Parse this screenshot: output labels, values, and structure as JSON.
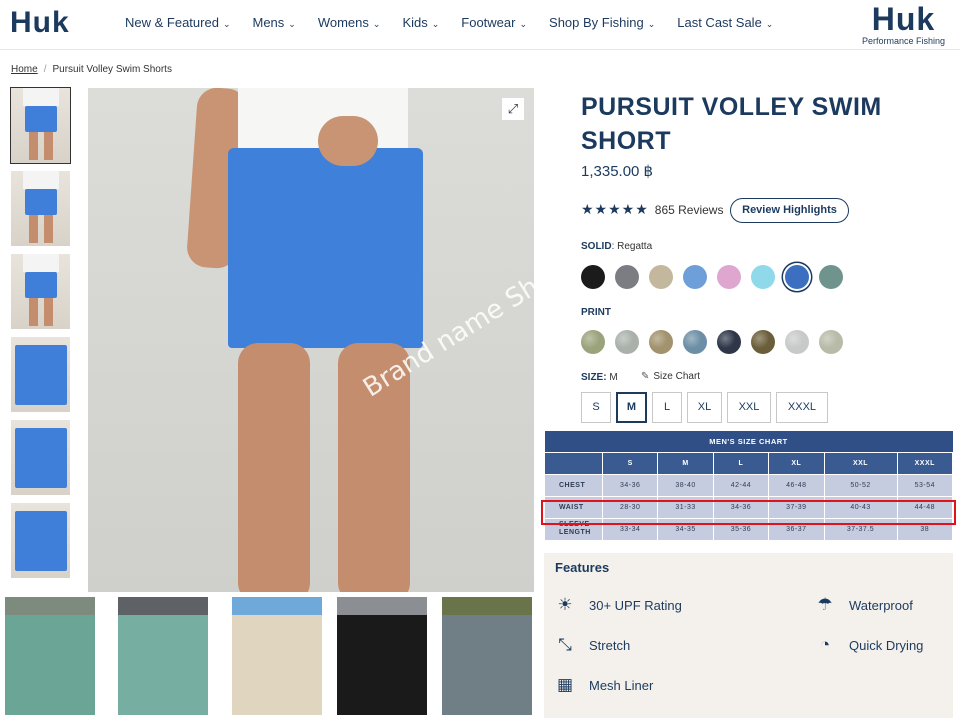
{
  "header": {
    "logo_left": "Huk",
    "nav": [
      "New & Featured",
      "Mens",
      "Womens",
      "Kids",
      "Footwear",
      "Shop By Fishing",
      "Last Cast Sale"
    ],
    "logo_right": {
      "big": "Huk",
      "small": "Performance Fishing"
    }
  },
  "breadcrumb": {
    "home": "Home",
    "current": "Pursuit Volley Swim Shorts"
  },
  "product": {
    "title": "PURSUIT VOLLEY SWIM SHORT",
    "price": "1,335.00 ฿",
    "stars": "★★★★★",
    "reviews": "865 Reviews",
    "review_highlights": "Review Highlights"
  },
  "color": {
    "label": "SOLID",
    "selected": ": Regatta",
    "swatches": [
      "#1b1b1b",
      "#7b7d82",
      "#c3b79d",
      "#6f9fd8",
      "#dfa7cf",
      "#8fd9ea",
      "#3c6fbf",
      "#6f948d"
    ],
    "selected_index": 6
  },
  "print": {
    "label": "PRINT",
    "swatches": [
      "#9aa37c",
      "#a9b1aa",
      "#a2926d",
      "#6d8fa6",
      "#2e3648",
      "#6b5e3a",
      "#c8c9c9",
      "#b8bba8"
    ]
  },
  "size": {
    "label": "SIZE:",
    "selected": "M",
    "chart_link": "Size Chart",
    "options": [
      "S",
      "M",
      "L",
      "XL",
      "XXL",
      "XXXL"
    ]
  },
  "size_chart": {
    "title": "MEN'S SIZE CHART",
    "columns": [
      "S",
      "M",
      "L",
      "XL",
      "XXL",
      "XXXL"
    ],
    "rows": [
      {
        "label": "CHEST",
        "values": [
          "34-36",
          "38-40",
          "42-44",
          "46-48",
          "50-52",
          "53-54"
        ]
      },
      {
        "label": "WAIST",
        "values": [
          "28-30",
          "31-33",
          "34-36",
          "37-39",
          "40-43",
          "44-48"
        ]
      },
      {
        "label": "SLEEVE LENGTH",
        "values": [
          "33-34",
          "34-35",
          "35-36",
          "36-37",
          "37-37.5",
          "38"
        ]
      }
    ]
  },
  "features": {
    "title": "Features",
    "items": [
      "30+ UPF Rating",
      "Waterproof",
      "Stretch",
      "Quick Drying",
      "Mesh Liner"
    ]
  },
  "watermark": "Brand name Shop",
  "image_colors": {
    "strip": [
      {
        "shirt": "#7d8b7f",
        "short": "#6aa596"
      },
      {
        "shirt": "#5e6267",
        "short": "#76aea1"
      },
      {
        "shirt": "#6fa9d9",
        "short": "#e0d6bf"
      },
      {
        "shirt": "#8b8f94",
        "short": "#1a1a1a"
      },
      {
        "shirt": "#69744a",
        "short": "#707f86"
      }
    ]
  }
}
